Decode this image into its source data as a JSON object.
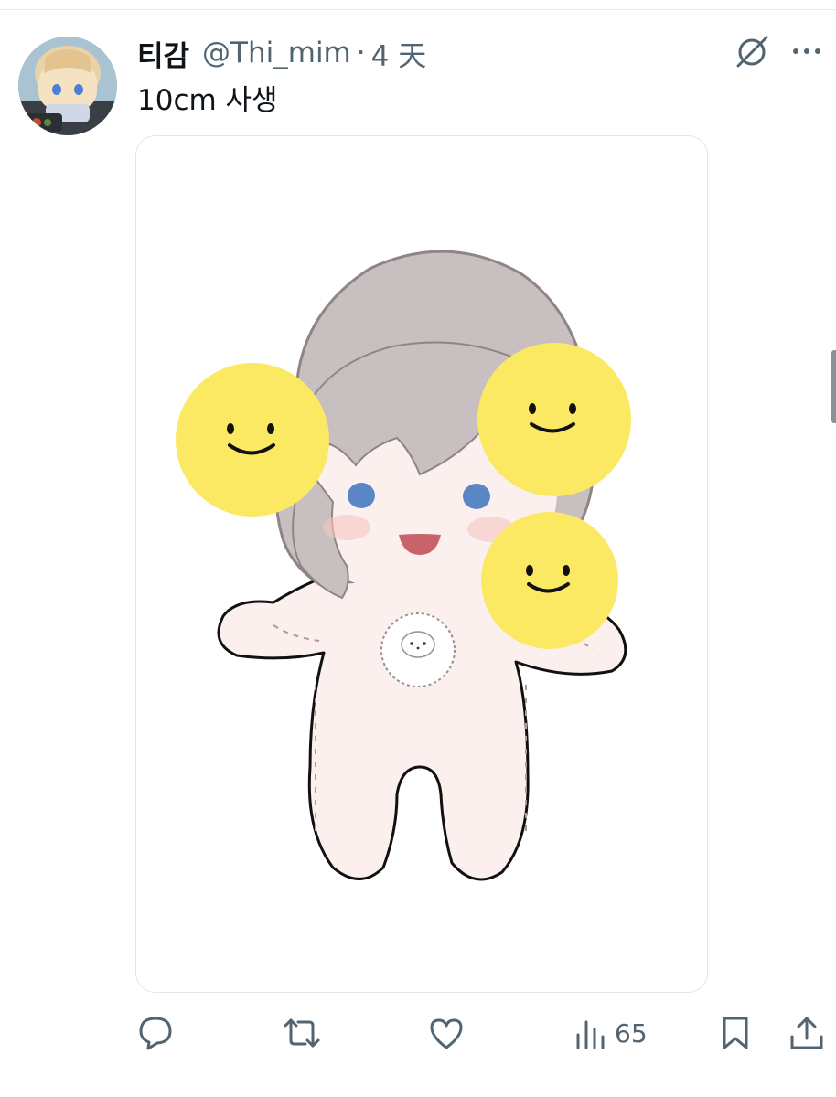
{
  "tweet": {
    "display_name": "티감",
    "handle": "@Thi_mim",
    "separator": "·",
    "time": "4 天",
    "text": "10cm 사생"
  },
  "header_icons": {
    "grok": "grok-icon",
    "more": "more-icon"
  },
  "actions": {
    "reply_icon": "reply-icon",
    "retweet_icon": "retweet-icon",
    "like_icon": "heart-icon",
    "views_icon": "views-chart-icon",
    "views_count": "65",
    "bookmark_icon": "bookmark-icon",
    "share_icon": "share-icon"
  },
  "colors": {
    "text_primary": "#0f1419",
    "text_secondary": "#536471",
    "emoji_yellow": "#fbe964",
    "hair_gray": "#c8c0c0",
    "body_pink": "#fbf0ee"
  }
}
